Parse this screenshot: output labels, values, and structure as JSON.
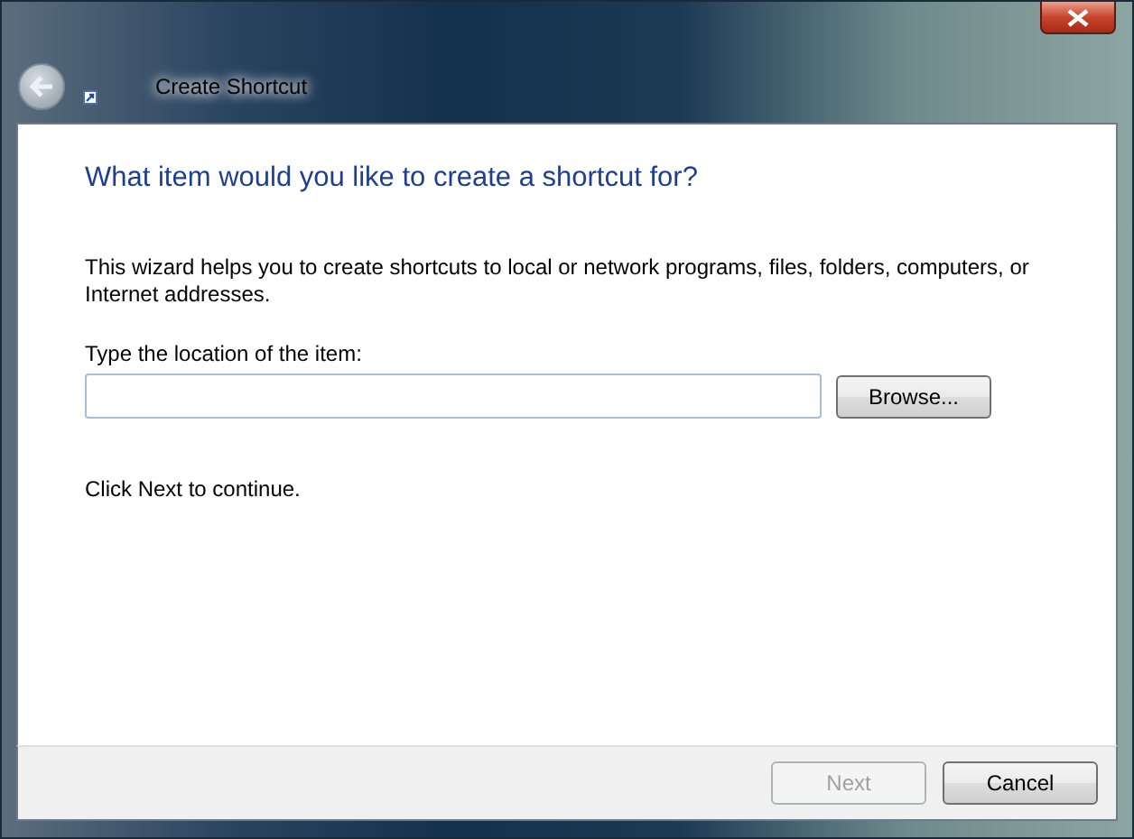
{
  "window": {
    "title": "Create Shortcut"
  },
  "heading": "What item would you like to create a shortcut for?",
  "description": "This wizard helps you to create shortcuts to local or network programs, files, folders, computers, or Internet addresses.",
  "location": {
    "label": "Type the location of the item:"
  },
  "browse_button": "Browse...",
  "hint": "Click Next to continue.",
  "buttons": [
    {
      "label": "Next",
      "disabled": true
    },
    {
      "label": "Cancel",
      "disabled": false
    }
  ]
}
